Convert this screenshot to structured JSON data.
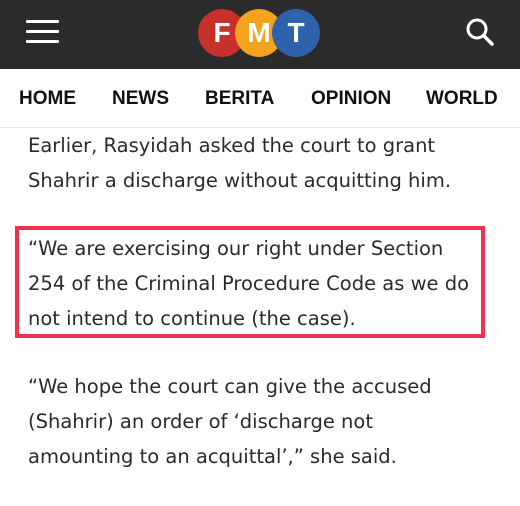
{
  "header": {
    "logo_letters": [
      "F",
      "M",
      "T"
    ],
    "logo_colors": [
      "#c6312b",
      "#f3a41c",
      "#2d63ad"
    ],
    "background": "#2b2b2b",
    "menu_icon": "hamburger-menu-icon",
    "search_icon": "search-icon"
  },
  "nav": {
    "items": [
      "HOME",
      "NEWS",
      "BERITA",
      "OPINION",
      "WORLD"
    ]
  },
  "article": {
    "paragraph1": [
      "Earlier, Rasyidah asked the court to grant",
      "Shahrir a discharge without acquitting him."
    ],
    "quote": [
      "“We are exercising our right under Section",
      "254 of the Criminal Procedure Code as we do",
      "not intend to continue (the case)."
    ],
    "paragraph3": [
      "“We hope the court can give the accused",
      "(Shahrir) an order of ‘discharge not",
      "amounting to an acquittal’,” she said."
    ],
    "highlight_color": "#f0304e"
  }
}
